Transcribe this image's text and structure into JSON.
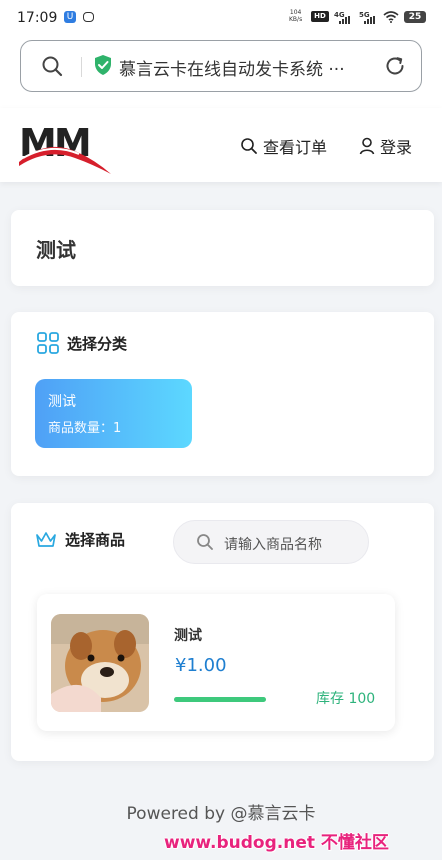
{
  "status_bar": {
    "time": "17:09",
    "network_speed_top": "104",
    "network_speed_unit": "KB/s",
    "hd_label": "HD",
    "sig1_label": "4G",
    "sig2_label": "5G",
    "battery": "25",
    "app_icon_label": "U"
  },
  "address_bar": {
    "url_text": "慕言云卡在线自动发卡系统 ···",
    "icons": [
      "search-icon",
      "shield-check-icon",
      "reload-icon"
    ]
  },
  "header": {
    "logo_text": "MM",
    "orders_label": "查看订单",
    "login_label": "登录"
  },
  "notice": {
    "title": "测试"
  },
  "category_section": {
    "heading": "选择分类",
    "categories": [
      {
        "name": "测试",
        "count_text": "商品数量：1"
      }
    ]
  },
  "product_section": {
    "heading": "选择商品",
    "search_placeholder": "请输入商品名称",
    "products": [
      {
        "name": "测试",
        "price": "¥1.00",
        "stock_text": "库存 100",
        "stock_fraction": 1.0
      }
    ]
  },
  "footer": {
    "text": "Powered by @慕言云卡"
  },
  "watermark": {
    "text": "www.budog.net 不懂社区"
  },
  "colors": {
    "accent_blue": "#1f7fd0",
    "tile_gradient_start": "#4fa0f6",
    "tile_gradient_end": "#5cd8ff",
    "stock_green": "#2eb37c",
    "watermark_pink": "#e8237d"
  }
}
